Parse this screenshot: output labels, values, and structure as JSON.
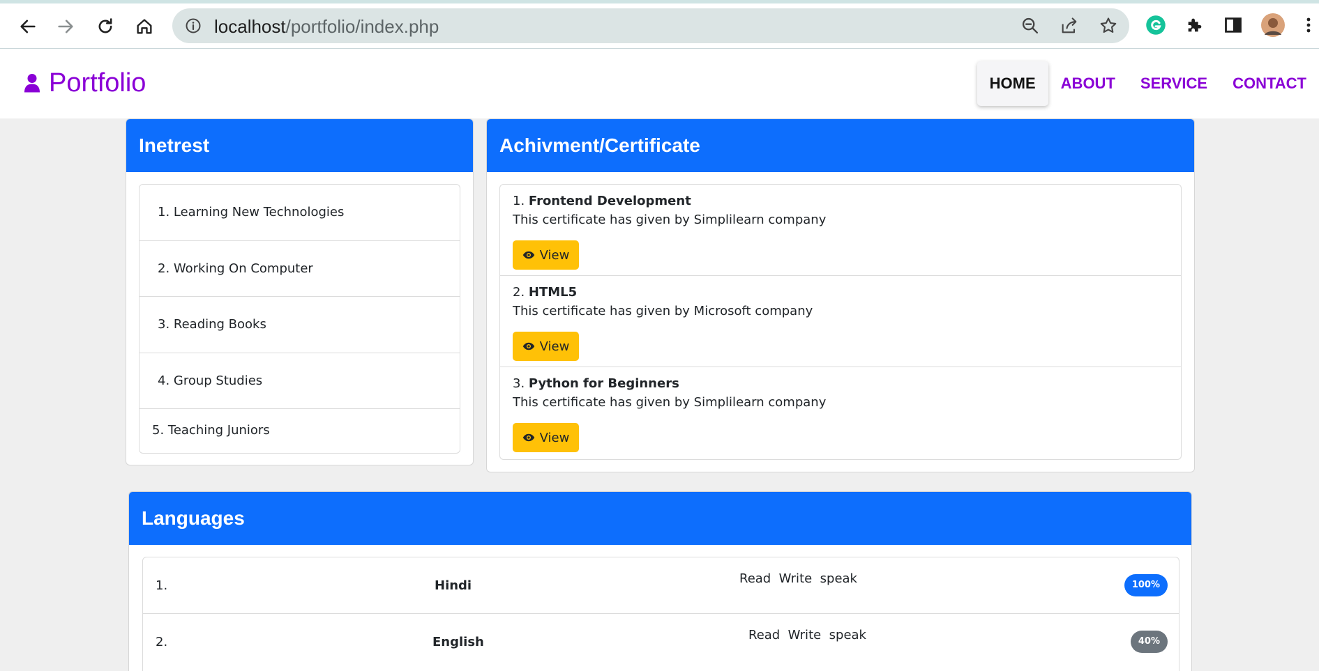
{
  "browser": {
    "url_host": "localhost",
    "url_path": "/portfolio/index.php"
  },
  "site": {
    "brand": "Portfolio",
    "nav": [
      "HOME",
      "ABOUT",
      "SERVICE",
      "CONTACT"
    ],
    "active_nav": "HOME"
  },
  "interest": {
    "title": "Inetrest",
    "items": [
      "1. Learning New Technologies",
      "2. Working On Computer",
      "3. Reading Books",
      "4. Group Studies",
      "5. Teaching Juniors"
    ]
  },
  "certificates": {
    "title": "Achivment/Certificate",
    "items": [
      {
        "num": "1.",
        "name": "Frontend Development",
        "desc": "This certificate has given by Simplilearn company",
        "button": "View"
      },
      {
        "num": "2.",
        "name": "HTML5",
        "desc": "This certificate has given by Microsoft company",
        "button": "View"
      },
      {
        "num": "3.",
        "name": "Python for Beginners",
        "desc": "This certificate has given by Simplilearn company",
        "button": "View"
      }
    ]
  },
  "languages": {
    "title": "Languages",
    "items": [
      {
        "num": "1.",
        "name": "Hindi",
        "skills": "Read  Write  speak",
        "level": "100%",
        "badge_color": "#0d6efd"
      },
      {
        "num": "2.",
        "name": "English",
        "skills": "Read  Write  speak",
        "level": "40%",
        "badge_color": "#6c757d"
      }
    ]
  },
  "colors": {
    "brand": "#8a00d6",
    "header_blue": "#0d6efd",
    "button_yellow": "#ffc107",
    "secondary_gray": "#6c757d"
  }
}
